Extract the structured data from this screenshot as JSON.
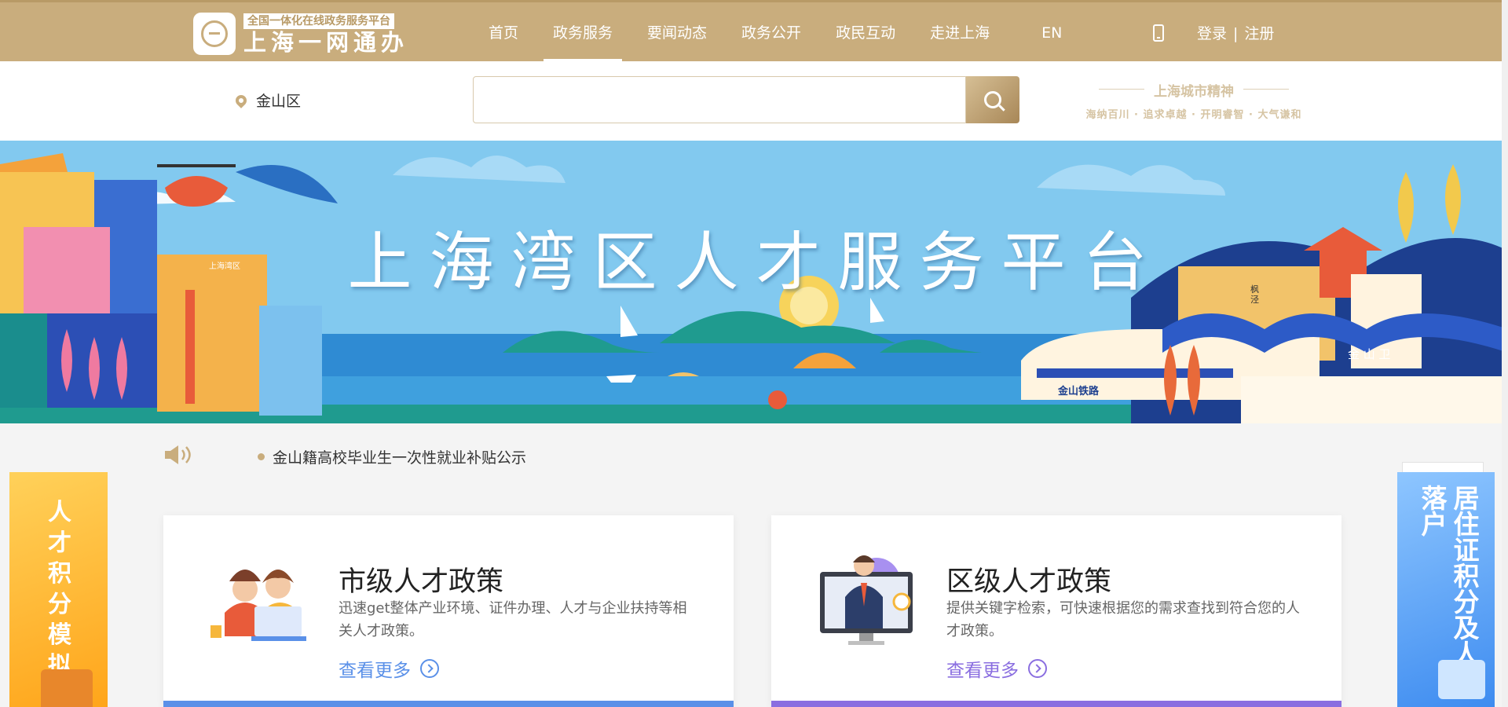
{
  "header": {
    "logo_tag": "全国一体化在线政务服务平台",
    "logo_title": "上海一网通办",
    "nav": [
      {
        "label": "首页"
      },
      {
        "label": "政务服务"
      },
      {
        "label": "要闻动态"
      },
      {
        "label": "政务公开"
      },
      {
        "label": "政民互动"
      },
      {
        "label": "走进上海"
      }
    ],
    "lang": "EN",
    "login": "登录",
    "separator": "|",
    "register": "注册"
  },
  "search_row": {
    "location": "金山区",
    "search_placeholder": "",
    "spirit_title": "上海城市精神",
    "spirit_sub": "海纳百川 · 追求卓越 · 开明睿智 · 大气谦和"
  },
  "banner": {
    "title": "上海湾区人才服务平台",
    "building_sign": "上海湾区",
    "train_label": "金山铁路",
    "gate_label": "枫泾",
    "town_label": "金 山 卫"
  },
  "notice": {
    "items": [
      "金山籍高校毕业生一次性就业补贴公示"
    ]
  },
  "side_left": {
    "text": "人才积分模拟"
  },
  "side_right": {
    "text": "居住证积分及人才落户"
  },
  "cards": [
    {
      "title": "市级人才政策",
      "desc": "迅速get整体产业环境、证件办理、人才与企业扶持等相关人才政策。",
      "more": "查看更多",
      "accent": "#5a90e8"
    },
    {
      "title": "区级人才政策",
      "desc": "提供关键字检索，可快速根据您的需求查找到符合您的人才政策。",
      "more": "查看更多",
      "accent": "#8a6ee0"
    }
  ],
  "colors": {
    "brand": "#c9ad7d",
    "banner_sky": "#82c9ef"
  }
}
